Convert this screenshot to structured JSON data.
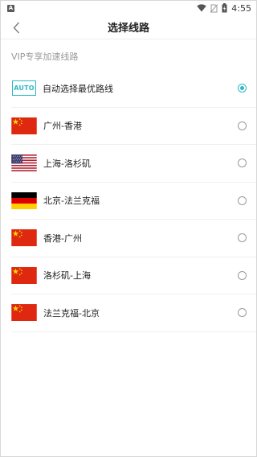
{
  "status_bar": {
    "badge": "A",
    "time": "4:55",
    "icons": [
      "wifi-icon",
      "sim-off-icon",
      "battery-icon"
    ]
  },
  "header": {
    "title": "选择线路",
    "back_icon": "chevron-left-icon"
  },
  "section": {
    "label": "VIP专享加速线路"
  },
  "routes": [
    {
      "label": "自动选择最优路线",
      "icon": "AUTO",
      "selected": true
    },
    {
      "label": "广州-香港",
      "icon": "china-flag-icon",
      "selected": false
    },
    {
      "label": "上海-洛杉矶",
      "icon": "usa-flag-icon",
      "selected": false
    },
    {
      "label": "北京-法兰克福",
      "icon": "germany-flag-icon",
      "selected": false
    },
    {
      "label": "香港-广州",
      "icon": "china-flag-icon",
      "selected": false
    },
    {
      "label": "洛杉矶-上海",
      "icon": "china-flag-icon",
      "selected": false
    },
    {
      "label": "法兰克福-北京",
      "icon": "china-flag-icon",
      "selected": false
    }
  ],
  "colors": {
    "accent": "#2bb9c9",
    "china_red": "#de2910",
    "china_yellow": "#ffde00"
  }
}
